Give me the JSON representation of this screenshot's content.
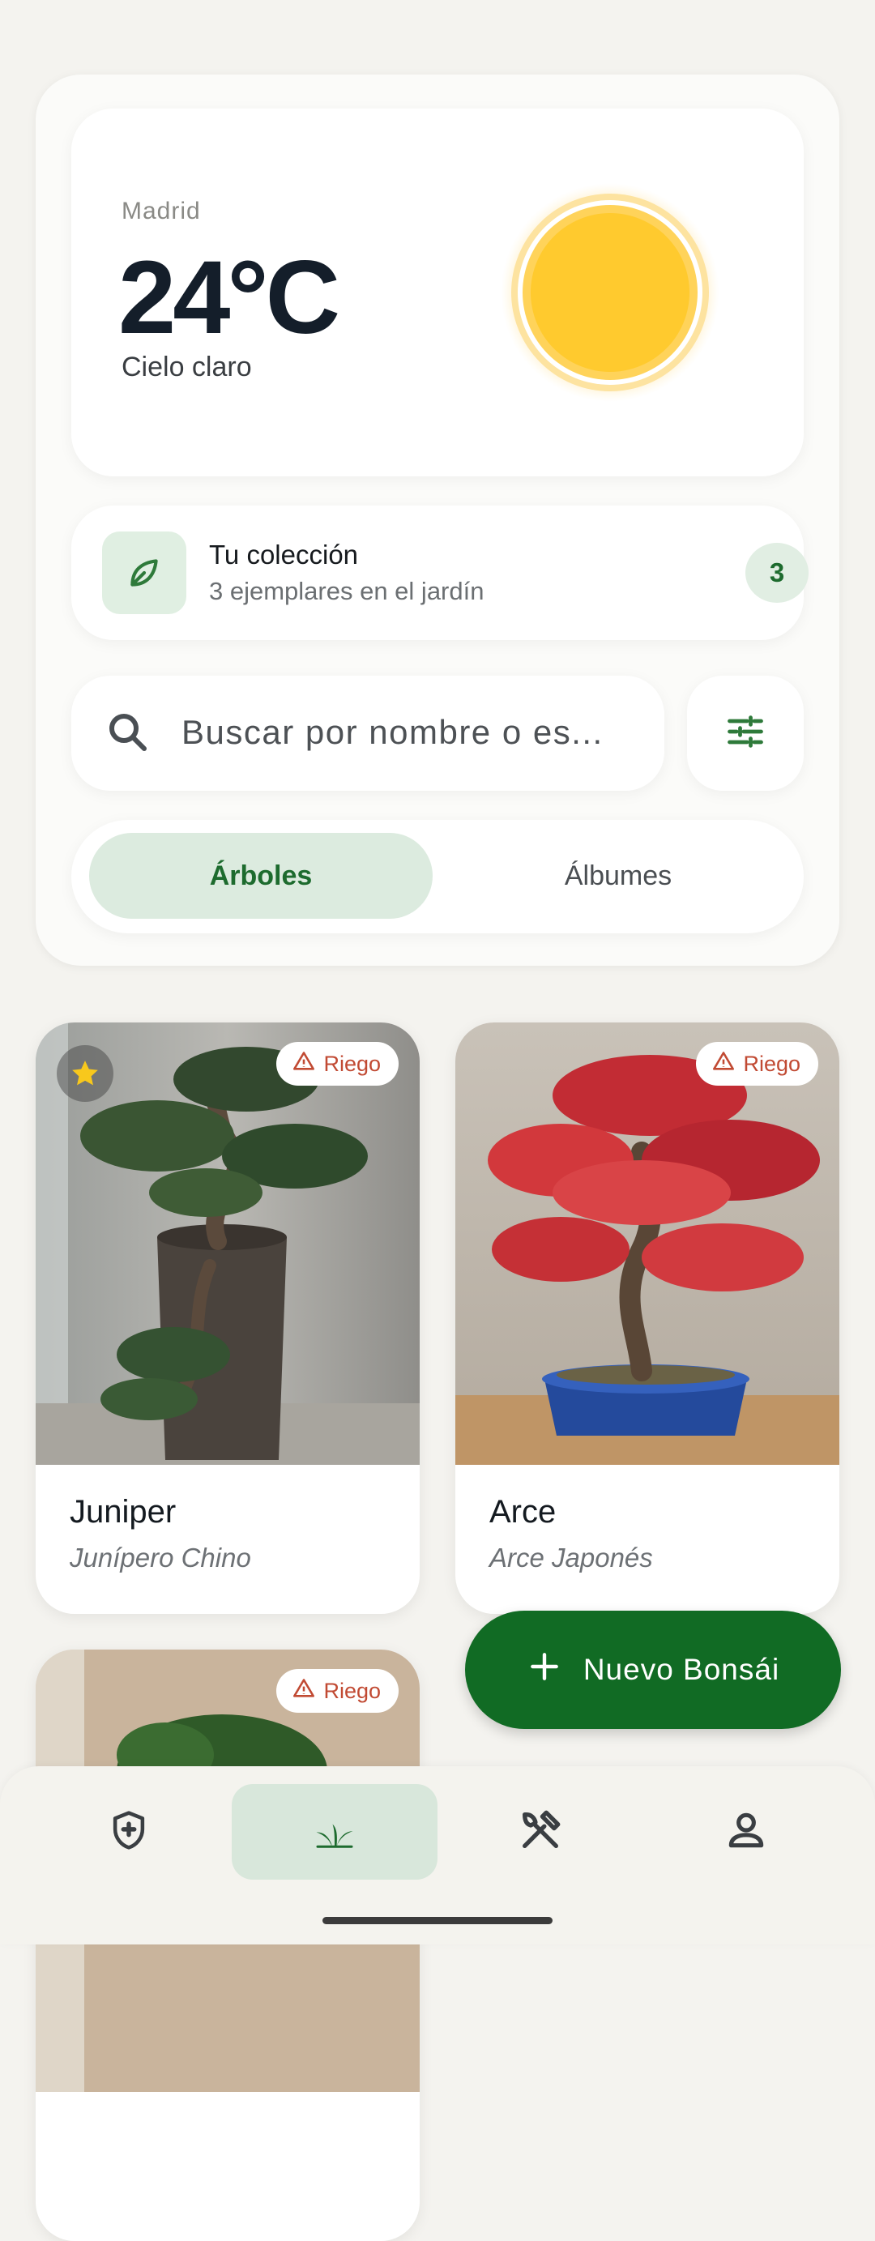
{
  "weather": {
    "city": "Madrid",
    "temperature": "24°C",
    "condition": "Cielo claro",
    "sun_color": "#ffcb30"
  },
  "collection": {
    "title": "Tu colección",
    "subtitle": "3 ejemplares en el jardín",
    "count": "3",
    "icon": "leaf-icon"
  },
  "search": {
    "placeholder": "Buscar por nombre o es...",
    "icon": "search-icon",
    "filter_icon": "tune-icon"
  },
  "tabs": [
    {
      "label": "Árboles",
      "active": true
    },
    {
      "label": "Álbumes",
      "active": false
    }
  ],
  "trees": [
    {
      "name": "Juniper",
      "species": "Junípero Chino",
      "alert": "Riego",
      "favorite": true
    },
    {
      "name": "Arce",
      "species": "Arce Japonés",
      "alert": "Riego",
      "favorite": false
    },
    {
      "name": "",
      "species": "",
      "alert": "Riego",
      "favorite": false
    }
  ],
  "fab": {
    "label": "Nuevo Bonsái",
    "icon": "plus-icon"
  },
  "bottom_nav": [
    {
      "icon": "health-shield-icon",
      "active": false
    },
    {
      "icon": "bonsai-icon",
      "active": true
    },
    {
      "icon": "tools-icon",
      "active": false
    },
    {
      "icon": "profile-icon",
      "active": false
    }
  ],
  "colors": {
    "primary": "#116b24",
    "accent_green_light": "#dcebdf",
    "alert": "#c14a33",
    "background": "#f4f3ef"
  }
}
